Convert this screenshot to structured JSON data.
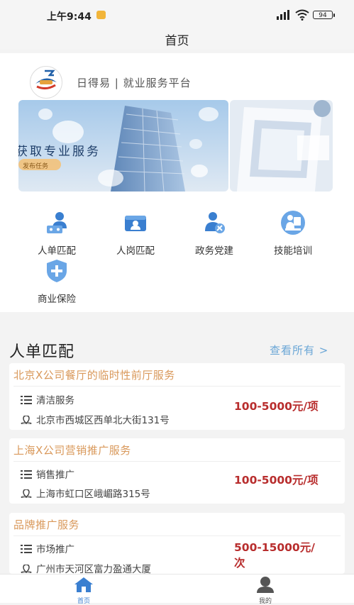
{
  "status_bar": {
    "time": "上午9:44",
    "battery": "94"
  },
  "nav": {
    "title": "首页"
  },
  "brand": {
    "name": "日得易 | 就业服务平台"
  },
  "banner": {
    "text": "获取专业服务",
    "subtext": "发布任务"
  },
  "quick_menu": [
    {
      "label": "人单匹配",
      "icon": "person-match-icon"
    },
    {
      "label": "人岗匹配",
      "icon": "id-card-icon"
    },
    {
      "label": "政务党建",
      "icon": "party-building-icon"
    },
    {
      "label": "技能培训",
      "icon": "training-icon"
    },
    {
      "label": "商业保险",
      "icon": "insurance-shield-icon"
    }
  ],
  "section": {
    "title": "人单匹配",
    "more": "查看所有 >"
  },
  "listings": [
    {
      "title": "北京X公司餐厅的临时性前厅服务",
      "category": "清洁服务",
      "address": "北京市西城区西单北大街131号",
      "price": "100-5000元/项"
    },
    {
      "title": "上海X公司营销推广服务",
      "category": "销售推广",
      "address": "上海市虹口区峨嵋路315号",
      "price": "100-5000元/项"
    },
    {
      "title": "品牌推广服务",
      "category": "市场推广",
      "address": "广州市天河区富力盈通大厦",
      "price": "500-15000元/\n次"
    }
  ],
  "tabbar": {
    "home": "首页",
    "mine": "我的"
  },
  "colors": {
    "accent": "#3a7fd0",
    "price": "#b82d2d",
    "listing_title": "#d9985a",
    "link": "#6aa6d6"
  }
}
